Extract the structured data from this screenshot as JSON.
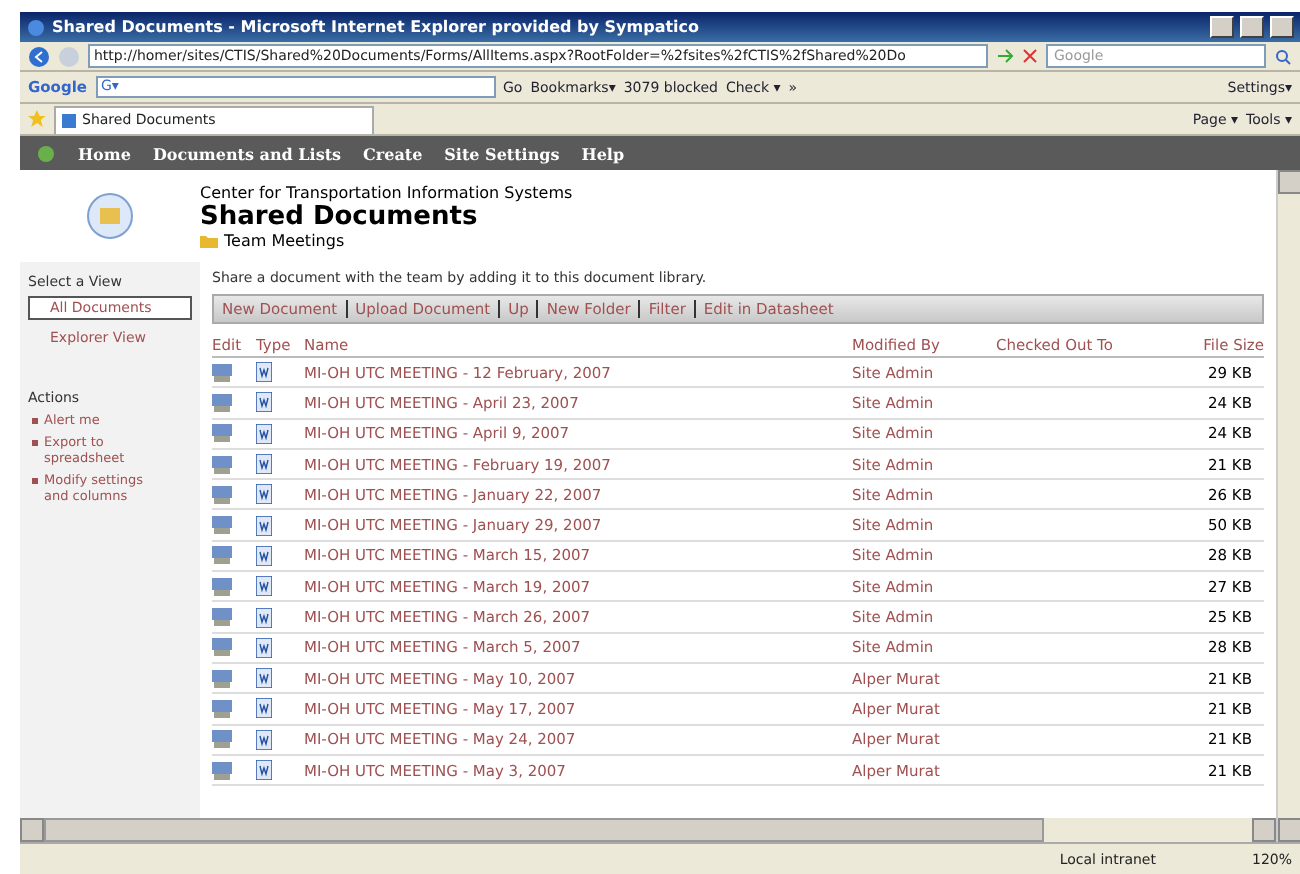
{
  "window": {
    "title": "Shared Documents - Microsoft Internet Explorer provided by Sympatico"
  },
  "address_bar": {
    "url": "http://homer/sites/CTIS/Shared%20Documents/Forms/AllItems.aspx?RootFolder=%2fsites%2fCTIS%2fShared%20Do",
    "search_placeholder": "Google"
  },
  "google_toolbar": {
    "logo": "Google",
    "field": "G▾",
    "items": [
      "Go",
      "Bookmarks▾",
      "3079 blocked",
      "Check ▾",
      "»"
    ],
    "settings": "Settings▾"
  },
  "tab": {
    "label": "Shared Documents"
  },
  "command_bar": [
    "Page ▾",
    "Tools ▾"
  ],
  "nav": [
    "Home",
    "Documents and Lists",
    "Create",
    "Site Settings",
    "Help"
  ],
  "header": {
    "site": "Center for Transportation Information Systems",
    "title": "Shared Documents",
    "folder": "Team Meetings"
  },
  "sidebar": {
    "views_heading": "Select a View",
    "views": [
      {
        "label": "All Documents",
        "selected": true
      },
      {
        "label": "Explorer View",
        "selected": false
      }
    ],
    "actions_heading": "Actions",
    "actions": [
      "Alert me",
      "Export to spreadsheet",
      "Modify settings and columns"
    ]
  },
  "description": "Share a document with the team by adding it to this document library.",
  "toolbar": [
    "New Document",
    "Upload Document",
    "Up",
    "New Folder",
    "Filter",
    "Edit in Datasheet"
  ],
  "columns": [
    "Edit",
    "Type",
    "Name",
    "Modified By",
    "Checked Out To",
    "File Size"
  ],
  "rows": [
    {
      "name": "MI-OH UTC MEETING - 12 February, 2007",
      "modified_by": "Site Admin",
      "size": "29 KB"
    },
    {
      "name": "MI-OH UTC MEETING - April 23, 2007",
      "modified_by": "Site Admin",
      "size": "24 KB"
    },
    {
      "name": "MI-OH UTC MEETING - April 9, 2007",
      "modified_by": "Site Admin",
      "size": "24 KB"
    },
    {
      "name": "MI-OH UTC MEETING - February 19, 2007",
      "modified_by": "Site Admin",
      "size": "21 KB"
    },
    {
      "name": "MI-OH UTC MEETING - January 22, 2007",
      "modified_by": "Site Admin",
      "size": "26 KB"
    },
    {
      "name": "MI-OH UTC MEETING - January 29, 2007",
      "modified_by": "Site Admin",
      "size": "50 KB"
    },
    {
      "name": "MI-OH UTC MEETING - March 15, 2007",
      "modified_by": "Site Admin",
      "size": "28 KB"
    },
    {
      "name": "MI-OH UTC MEETING - March 19, 2007",
      "modified_by": "Site Admin",
      "size": "27 KB"
    },
    {
      "name": "MI-OH UTC MEETING - March 26, 2007",
      "modified_by": "Site Admin",
      "size": "25 KB"
    },
    {
      "name": "MI-OH UTC MEETING - March 5, 2007",
      "modified_by": "Site Admin",
      "size": "28 KB"
    },
    {
      "name": "MI-OH UTC MEETING - May 10, 2007",
      "modified_by": "Alper Murat",
      "size": "21 KB"
    },
    {
      "name": "MI-OH UTC MEETING - May 17, 2007",
      "modified_by": "Alper Murat",
      "size": "21 KB"
    },
    {
      "name": "MI-OH UTC MEETING - May 24, 2007",
      "modified_by": "Alper Murat",
      "size": "21 KB"
    },
    {
      "name": "MI-OH UTC MEETING - May 3, 2007",
      "modified_by": "Alper Murat",
      "size": "21 KB"
    }
  ],
  "status_bar": {
    "zone": "Local intranet",
    "zoom": "120%"
  }
}
